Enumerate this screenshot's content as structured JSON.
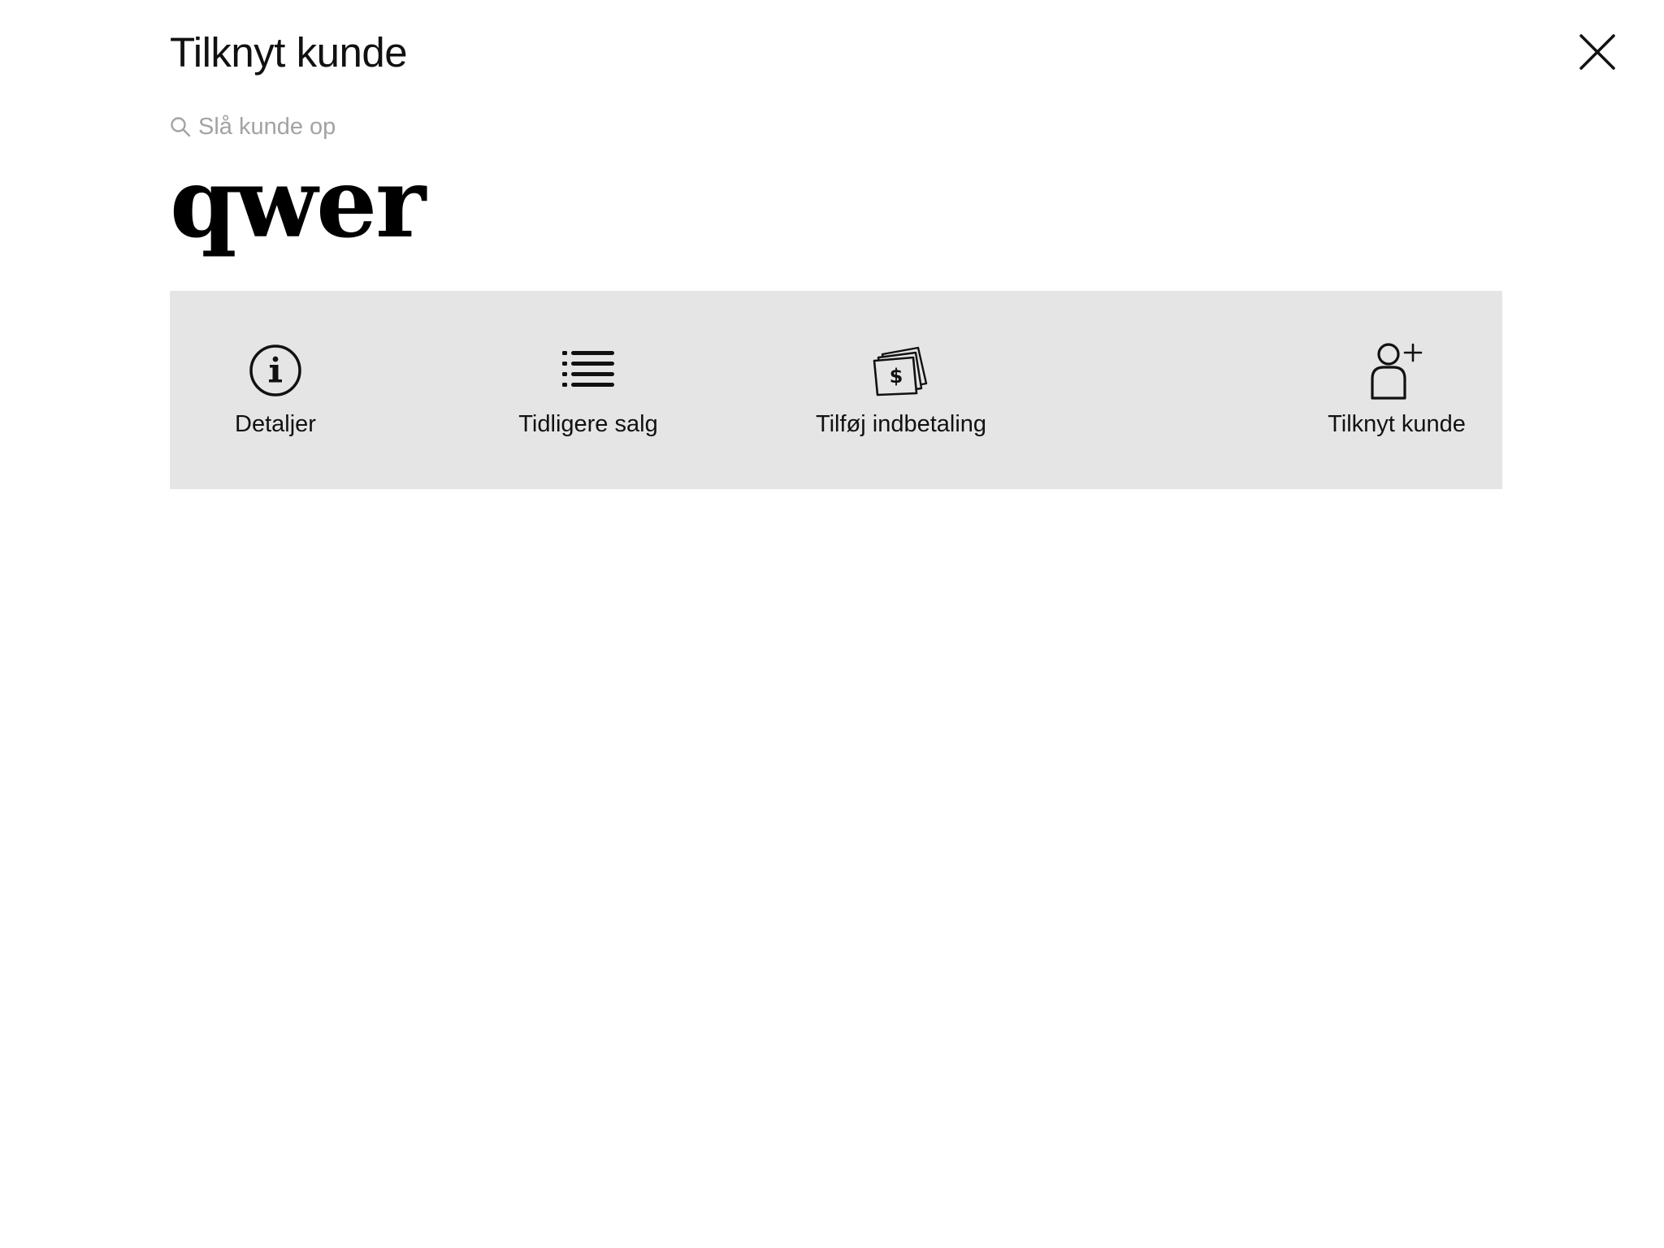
{
  "header": {
    "title": "Tilknyt kunde",
    "close_icon": "close-icon"
  },
  "search": {
    "placeholder": "Slå kunde op",
    "value": "",
    "icon": "search-icon"
  },
  "customer": {
    "name": "qwer"
  },
  "actions": [
    {
      "label": "Detaljer",
      "icon": "info-circle-icon"
    },
    {
      "label": "Tidligere salg",
      "icon": "list-icon"
    },
    {
      "label": "Tilføj indbetaling",
      "icon": "cash-icon"
    },
    {
      "label": "Tilknyt kunde",
      "icon": "add-person-icon"
    }
  ],
  "colors": {
    "action_bar_background": "#e5e5e5",
    "placeholder": "#a3a3a3",
    "text": "#111111"
  }
}
